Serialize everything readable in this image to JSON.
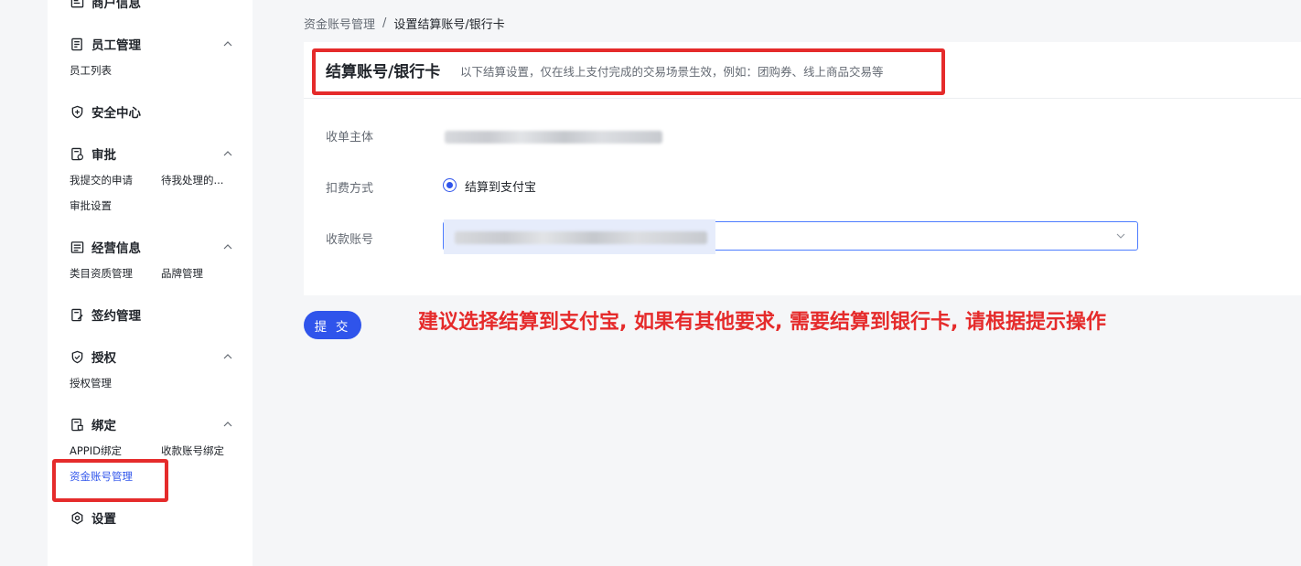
{
  "sidebar": {
    "groups": {
      "merchant": {
        "title": "商户信息"
      },
      "staff": {
        "title": "员工管理",
        "items": [
          "员工列表"
        ]
      },
      "security": {
        "title": "安全中心"
      },
      "approval": {
        "title": "审批",
        "items": [
          "我提交的申请",
          "待我处理的...",
          "审批设置"
        ]
      },
      "business": {
        "title": "经营信息",
        "items": [
          "类目资质管理",
          "品牌管理"
        ]
      },
      "contract": {
        "title": "签约管理"
      },
      "auth": {
        "title": "授权",
        "items": [
          "授权管理"
        ]
      },
      "binding": {
        "title": "绑定",
        "items": [
          "APPID绑定",
          "收款账号绑定",
          "资金账号管理"
        ]
      },
      "settings": {
        "title": "设置"
      }
    }
  },
  "breadcrumb": {
    "parent": "资金账号管理",
    "separator": "/",
    "current": "设置结算账号/银行卡"
  },
  "card": {
    "title": "结算账号/银行卡",
    "description": "以下结算设置，仅在线上支付完成的交易场景生效，例如：团购券、线上商品交易等"
  },
  "form": {
    "payee_label": "收单主体",
    "deduct_label": "扣费方式",
    "deduct_option": "结算到支付宝",
    "account_label": "收款账号"
  },
  "submit_label": "提 交",
  "annotation": "建议选择结算到支付宝, 如果有其他要求, 需要结算到银行卡, 请根据提示操作",
  "colors": {
    "accent": "#2f54eb",
    "annotation_red": "#e52b2b"
  }
}
